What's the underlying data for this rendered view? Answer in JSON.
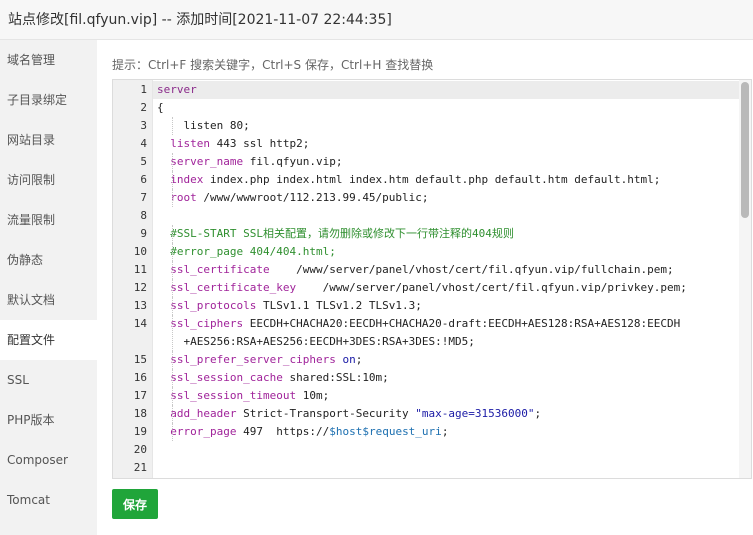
{
  "window": {
    "title": "站点修改[fil.qfyun.vip] -- 添加时间[2021-11-07 22:44:35]"
  },
  "sidebar": {
    "items": [
      {
        "label": "域名管理",
        "active": false
      },
      {
        "label": "子目录绑定",
        "active": false
      },
      {
        "label": "网站目录",
        "active": false
      },
      {
        "label": "访问限制",
        "active": false
      },
      {
        "label": "流量限制",
        "active": false
      },
      {
        "label": "伪静态",
        "active": false
      },
      {
        "label": "默认文档",
        "active": false
      },
      {
        "label": "配置文件",
        "active": true
      },
      {
        "label": "SSL",
        "active": false
      },
      {
        "label": "PHP版本",
        "active": false
      },
      {
        "label": "Composer",
        "active": false
      },
      {
        "label": "Tomcat",
        "active": false
      }
    ]
  },
  "editor": {
    "tip": "提示：Ctrl+F 搜索关键字，Ctrl+S 保存，Ctrl+H 查找替换",
    "lines": [
      {
        "num": "1",
        "indent": 0,
        "segments": [
          {
            "t": "server",
            "c": "kw"
          }
        ]
      },
      {
        "num": "2",
        "indent": 0,
        "segments": [
          {
            "t": "{",
            "c": ""
          }
        ]
      },
      {
        "num": "3",
        "indent": 1,
        "segments": [
          {
            "t": "    listen 80;",
            "c": ""
          }
        ]
      },
      {
        "num": "4",
        "indent": 0,
        "segments": [
          {
            "t": "  ",
            "c": ""
          },
          {
            "t": "listen",
            "c": "dir"
          },
          {
            "t": " 443 ssl http2;",
            "c": ""
          }
        ]
      },
      {
        "num": "5",
        "indent": 1,
        "segments": [
          {
            "t": "  ",
            "c": ""
          },
          {
            "t": "server_name",
            "c": "dir"
          },
          {
            "t": " fil.qfyun.vip;",
            "c": ""
          }
        ]
      },
      {
        "num": "6",
        "indent": 1,
        "segments": [
          {
            "t": "  ",
            "c": ""
          },
          {
            "t": "index",
            "c": "dir"
          },
          {
            "t": " index.php index.html index.htm default.php default.htm default.html;",
            "c": ""
          }
        ]
      },
      {
        "num": "7",
        "indent": 1,
        "segments": [
          {
            "t": "  ",
            "c": ""
          },
          {
            "t": "root",
            "c": "dir"
          },
          {
            "t": " /www/wwwroot/112.213.99.45/public;",
            "c": ""
          }
        ]
      },
      {
        "num": "8",
        "indent": 1,
        "segments": [
          {
            "t": "",
            "c": ""
          }
        ]
      },
      {
        "num": "9",
        "indent": 1,
        "segments": [
          {
            "t": "  ",
            "c": ""
          },
          {
            "t": "#SSL-START SSL相关配置，请勿删除或修改下一行带注释的404规则",
            "c": "cm"
          }
        ]
      },
      {
        "num": "10",
        "indent": 1,
        "segments": [
          {
            "t": "  ",
            "c": ""
          },
          {
            "t": "#error_page 404/404.html;",
            "c": "cm"
          }
        ]
      },
      {
        "num": "11",
        "indent": 1,
        "segments": [
          {
            "t": "  ",
            "c": ""
          },
          {
            "t": "ssl_certificate",
            "c": "dir"
          },
          {
            "t": "    /www/server/panel/vhost/cert/fil.qfyun.vip/fullchain.pem;",
            "c": ""
          }
        ]
      },
      {
        "num": "12",
        "indent": 1,
        "segments": [
          {
            "t": "  ",
            "c": ""
          },
          {
            "t": "ssl_certificate_key",
            "c": "dir"
          },
          {
            "t": "    /www/server/panel/vhost/cert/fil.qfyun.vip/privkey.pem;",
            "c": ""
          }
        ]
      },
      {
        "num": "13",
        "indent": 1,
        "segments": [
          {
            "t": "  ",
            "c": ""
          },
          {
            "t": "ssl_protocols",
            "c": "dir"
          },
          {
            "t": " TLSv1.1 TLSv1.2 TLSv1.3;",
            "c": ""
          }
        ]
      },
      {
        "num": "14",
        "indent": 1,
        "wrap": true,
        "segments": [
          {
            "t": "  ",
            "c": ""
          },
          {
            "t": "ssl_ciphers",
            "c": "dir"
          },
          {
            "t": " EECDH+CHACHA20:EECDH+CHACHA20-draft:EECDH+AES128:RSA+AES128:EECDH\n    +AES256:RSA+AES256:EECDH+3DES:RSA+3DES:!MD5;",
            "c": ""
          }
        ]
      },
      {
        "num": "15",
        "indent": 1,
        "segments": [
          {
            "t": "  ",
            "c": ""
          },
          {
            "t": "ssl_prefer_server_ciphers",
            "c": "dir"
          },
          {
            "t": " ",
            "c": ""
          },
          {
            "t": "on",
            "c": "str"
          },
          {
            "t": ";",
            "c": ""
          }
        ]
      },
      {
        "num": "16",
        "indent": 1,
        "segments": [
          {
            "t": "  ",
            "c": ""
          },
          {
            "t": "ssl_session_cache",
            "c": "dir"
          },
          {
            "t": " shared:SSL:10m;",
            "c": ""
          }
        ]
      },
      {
        "num": "17",
        "indent": 1,
        "segments": [
          {
            "t": "  ",
            "c": ""
          },
          {
            "t": "ssl_session_timeout",
            "c": "dir"
          },
          {
            "t": " 10m;",
            "c": ""
          }
        ]
      },
      {
        "num": "18",
        "indent": 1,
        "segments": [
          {
            "t": "  ",
            "c": ""
          },
          {
            "t": "add_header",
            "c": "dir"
          },
          {
            "t": " Strict-Transport-Security ",
            "c": ""
          },
          {
            "t": "\"max-age=31536000\"",
            "c": "str"
          },
          {
            "t": ";",
            "c": ""
          }
        ]
      },
      {
        "num": "19",
        "indent": 1,
        "segments": [
          {
            "t": "  ",
            "c": ""
          },
          {
            "t": "error_page",
            "c": "dir"
          },
          {
            "t": " 497  https://",
            "c": ""
          },
          {
            "t": "$host",
            "c": "var"
          },
          {
            "t": "$request_uri",
            "c": "var"
          },
          {
            "t": ";",
            "c": ""
          }
        ]
      },
      {
        "num": "20",
        "indent": 0,
        "segments": [
          {
            "t": "",
            "c": ""
          }
        ]
      },
      {
        "num": "21",
        "indent": 0,
        "segments": [
          {
            "t": "",
            "c": ""
          }
        ]
      }
    ]
  },
  "actions": {
    "save_label": "保存"
  },
  "colors": {
    "accent": "#20a53a",
    "sidebar_bg": "#f2f2f2",
    "comment": "#2f8f2f",
    "directive": "#a0239a"
  }
}
